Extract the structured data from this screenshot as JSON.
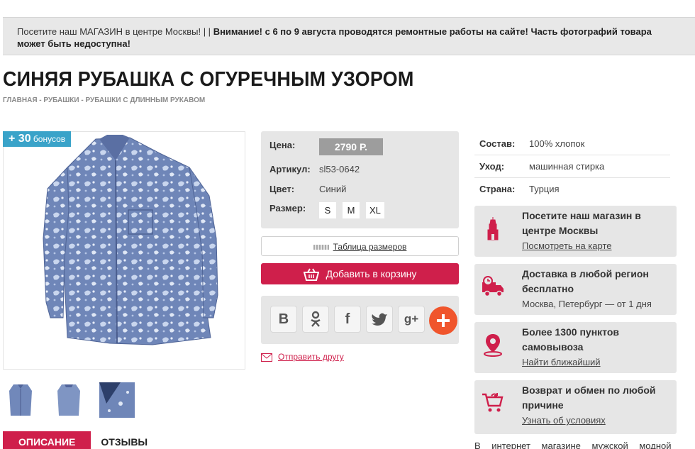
{
  "notice": {
    "plain": "Посетите наш МАГАЗИН в центре Москвы! | | ",
    "bold": "Внимание! с 6 по 9 августа проводятся ремонтные работы на сайте! Часть фотографий товара может быть недоступна!"
  },
  "page_title": "СИНЯЯ РУБАШКА С ОГУРЕЧНЫМ УЗОРОМ",
  "breadcrumb": {
    "home": "Главная",
    "sep": " - ",
    "shirts": "Рубашки",
    "current": "Рубашки с длинным рукавом"
  },
  "bonus": {
    "amount": "+ 30",
    "label": " бонусов"
  },
  "product": {
    "price_label": "Цена:",
    "price": "2790 Р.",
    "article_label": "Артикул:",
    "article": "sl53-0642",
    "color_label": "Цвет:",
    "color": "Синий",
    "size_label": "Размер:",
    "sizes": [
      "S",
      "M",
      "XL"
    ]
  },
  "size_table_link": "Таблица размеров",
  "add_to_cart": "Добавить в корзину",
  "share": {
    "vk": "В",
    "gplus": "g+"
  },
  "send_friend": "Отправить другу",
  "specs": [
    {
      "key": "Состав:",
      "value": "100% хлопок"
    },
    {
      "key": "Уход:",
      "value": "машинная стирка"
    },
    {
      "key": "Страна:",
      "value": "Турция"
    }
  ],
  "info_blocks": [
    {
      "title": "Посетите наш магазин в центре Москвы",
      "sub": "Посмотреть на карте"
    },
    {
      "title": "Доставка в любой регион бесплатно",
      "sub": "Москва, Петербург — от 1 дня"
    },
    {
      "title": "Более 1300 пунктов самовывоза",
      "sub": "Найти ближайший"
    },
    {
      "title": "Возврат и обмен по любой причине",
      "sub": "Узнать об условиях"
    }
  ],
  "tabs": {
    "description": "Описание",
    "reviews": "Отзывы"
  },
  "bottom_text": "В интернет магазине мужской модной",
  "colors": {
    "accent": "#cf1f4b",
    "bonus": "#3aa3c9",
    "share_plus": "#f0552c",
    "panel": "#e6e6e6"
  }
}
